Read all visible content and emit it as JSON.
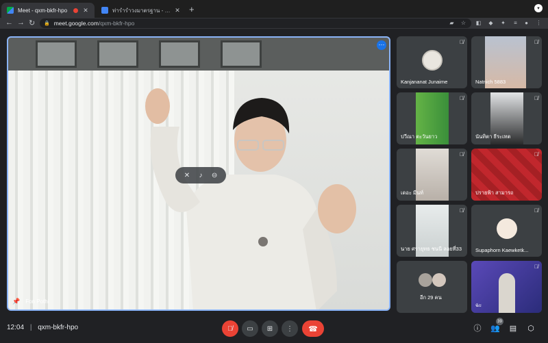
{
  "browser": {
    "tabs": [
      {
        "title": "Meet - qxm-bkfr-hpo",
        "active": true,
        "recording": true
      },
      {
        "title": "ท่ารำรำวงมาตรฐาน - รำวงมาตรฐาน",
        "active": false
      }
    ],
    "new_tab": "+",
    "url_domain": "meet.google.com",
    "url_path": "/qxm-bkfr-hpo"
  },
  "stage": {
    "speaker_name": "Fon Pothi"
  },
  "participants": [
    {
      "name": "Kanjananat Junaime",
      "color": "#3c4043"
    },
    {
      "name": "Natnich 5883",
      "color": "#d9c2b3"
    },
    {
      "name": "ปวีณา ตะวันยาว",
      "color": "#3a8f3a"
    },
    {
      "name": "นันทิตา ธีระเทต",
      "color": "#2c2d2e"
    },
    {
      "name": "เดอะ มีนท์",
      "color": "#d6d0ca"
    },
    {
      "name": "ปรายฟ้า สามารถ",
      "color": "#b23a3a"
    },
    {
      "name": "นาย ศรายุทธ ชนนี ลอยที่33",
      "color": "#dfe3e3"
    },
    {
      "name": "Supaphorn Kaewketk...",
      "color": "#3c4043"
    },
    {
      "name": "อีก 29 คน",
      "color": "#3c4043"
    },
    {
      "name": "ฉะ",
      "color": "#3b3f8f"
    }
  ],
  "bottom": {
    "time": "12:04",
    "separator": "|",
    "meeting_code": "qxm-bkfr-hpo",
    "participant_count": "39"
  }
}
